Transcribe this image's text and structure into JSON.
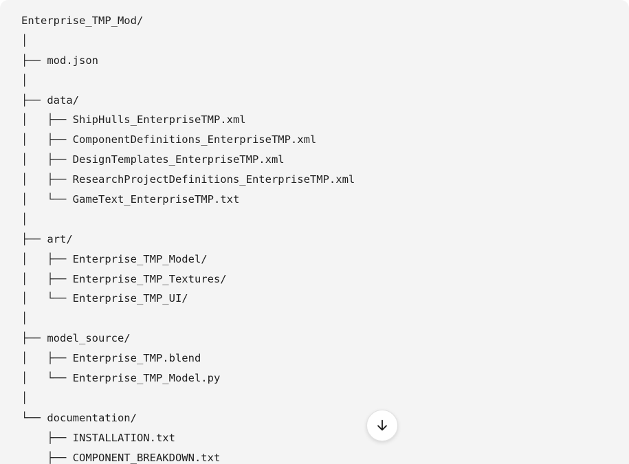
{
  "tree": {
    "lines": [
      {
        "prefix": "",
        "name": "Enterprise_TMP_Mod/"
      },
      {
        "prefix": "│",
        "name": ""
      },
      {
        "prefix": "├── ",
        "name": "mod.json"
      },
      {
        "prefix": "│",
        "name": ""
      },
      {
        "prefix": "├── ",
        "name": "data/"
      },
      {
        "prefix": "│   ├── ",
        "name": "ShipHulls_EnterpriseTMP.xml"
      },
      {
        "prefix": "│   ├── ",
        "name": "ComponentDefinitions_EnterpriseTMP.xml"
      },
      {
        "prefix": "│   ├── ",
        "name": "DesignTemplates_EnterpriseTMP.xml"
      },
      {
        "prefix": "│   ├── ",
        "name": "ResearchProjectDefinitions_EnterpriseTMP.xml"
      },
      {
        "prefix": "│   └── ",
        "name": "GameText_EnterpriseTMP.txt"
      },
      {
        "prefix": "│",
        "name": ""
      },
      {
        "prefix": "├── ",
        "name": "art/"
      },
      {
        "prefix": "│   ├── ",
        "name": "Enterprise_TMP_Model/"
      },
      {
        "prefix": "│   ├── ",
        "name": "Enterprise_TMP_Textures/"
      },
      {
        "prefix": "│   └── ",
        "name": "Enterprise_TMP_UI/"
      },
      {
        "prefix": "│",
        "name": ""
      },
      {
        "prefix": "├── ",
        "name": "model_source/"
      },
      {
        "prefix": "│   ├── ",
        "name": "Enterprise_TMP.blend"
      },
      {
        "prefix": "│   └── ",
        "name": "Enterprise_TMP_Model.py"
      },
      {
        "prefix": "│",
        "name": ""
      },
      {
        "prefix": "└── ",
        "name": "documentation/"
      },
      {
        "prefix": "    ├── ",
        "name": "INSTALLATION.txt"
      },
      {
        "prefix": "    ├── ",
        "name": "COMPONENT_BREAKDOWN.txt"
      }
    ]
  },
  "scroll_button": {
    "icon": "arrow-down-icon"
  }
}
